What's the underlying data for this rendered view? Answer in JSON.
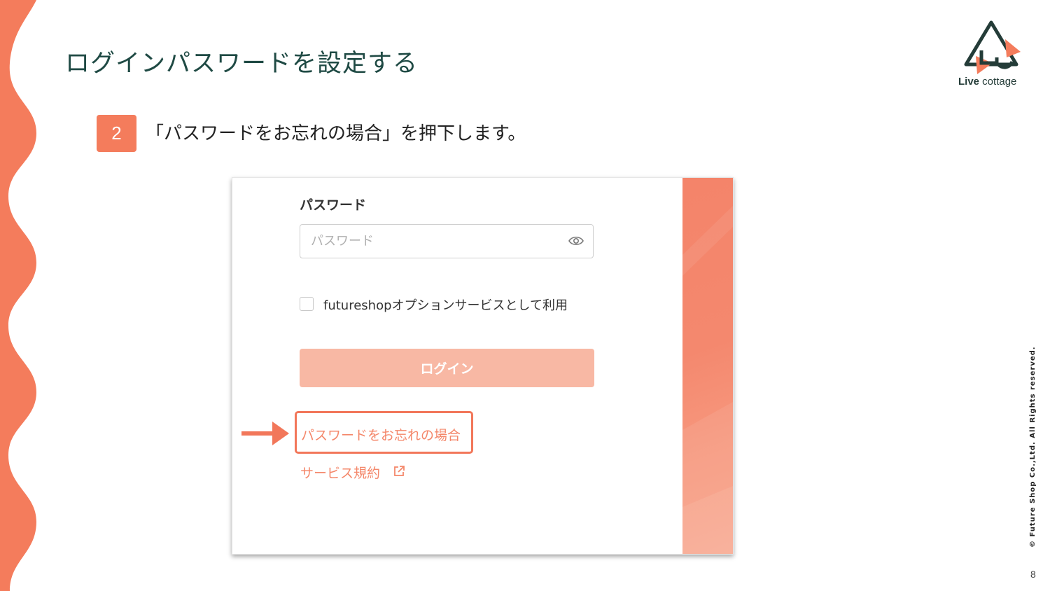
{
  "slide": {
    "title": "ログインパスワードを設定する",
    "step_number": "2",
    "instruction": "「パスワードをお忘れの場合」を押下します。",
    "page_number": "8",
    "copyright": "© Future Shop Co.,Ltd. All Rights reserved."
  },
  "logo": {
    "brand_bold": "Live",
    "brand_rest": " cottage",
    "icon": "house-logo-icon"
  },
  "login_form": {
    "password_label": "パスワード",
    "password_placeholder": "パスワード",
    "password_value": "",
    "show_password_icon": "eye-icon",
    "option_checkbox_label": "futureshopオプションサービスとして利用",
    "option_checked": false,
    "login_button_label": "ログイン",
    "forgot_password_link": "パスワードをお忘れの場合",
    "terms_link": "サービス規約",
    "terms_icon": "external-link-icon"
  },
  "colors": {
    "accent": "#f47c5c",
    "title": "#1f4a44",
    "link": "#f4876a",
    "button_disabled": "#f8b8a4",
    "highlight_border": "#f2775a"
  }
}
